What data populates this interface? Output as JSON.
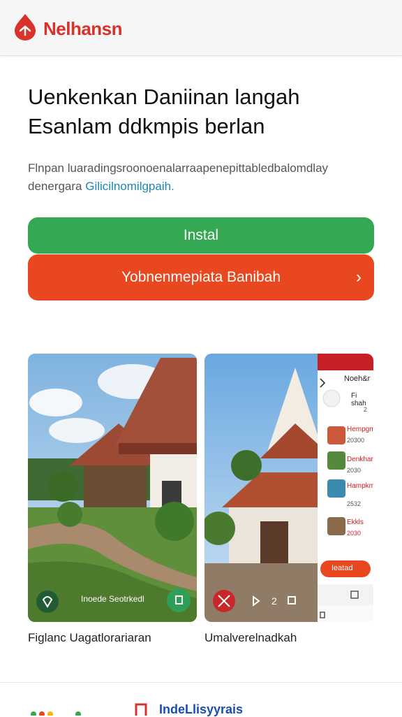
{
  "header": {
    "app_name": "Nelhansn",
    "logo_icon": "red-drop-logo-icon",
    "brand_color": "#d8322a"
  },
  "hero": {
    "title_line1": "Uenkenkan Daniinan langah",
    "title_line2": "Esanlam ddkmpis berlan",
    "desc_line1": "Flnpan  luaradingsroonoenalarraapenepittabledbalomdlay",
    "desc_line2_prefix": "denergara ",
    "desc_line2_link": "Gilicilnomilgpaih."
  },
  "actions": {
    "install_label": "Instal",
    "install_color": "#34a853",
    "secondary_label": "Yobnenmepiata Banibah",
    "secondary_color": "#e8471f",
    "secondary_chevron_icon": "chevron-right-icon"
  },
  "screenshots": [
    {
      "caption": "Figlanc Uagatlorariaran",
      "badge_text": "Inoede Seotrkedl"
    },
    {
      "caption": "Umalverelnadkah",
      "panel_title": "Noeh&r",
      "panel_items": [
        {
          "name": "Fi shah",
          "sub": "2"
        },
        {
          "name": "Hempgm",
          "sub": "20300"
        },
        {
          "name": "Denkhan",
          "sub": "2030"
        },
        {
          "name": "Hampkm",
          "sub": "2532"
        },
        {
          "name": "Ekkls",
          "sub": "2030"
        }
      ],
      "panel_button": "Ieatad"
    }
  ],
  "footer": {
    "link_text": "IndeLlisyyrais"
  }
}
